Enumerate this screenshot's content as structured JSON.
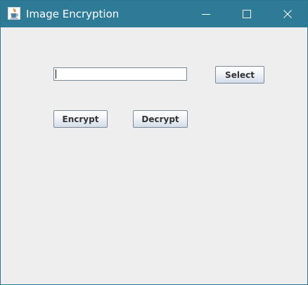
{
  "window": {
    "title": "Image Encryption",
    "app_icon": "java-icon",
    "controls": {
      "minimize_icon": "minimize-icon",
      "maximize_icon": "maximize-icon",
      "close_icon": "close-icon"
    },
    "titlebar_color": "#2e7b98"
  },
  "form": {
    "file_path_value": "",
    "select_label": "Select",
    "encrypt_label": "Encrypt",
    "decrypt_label": "Decrypt"
  }
}
